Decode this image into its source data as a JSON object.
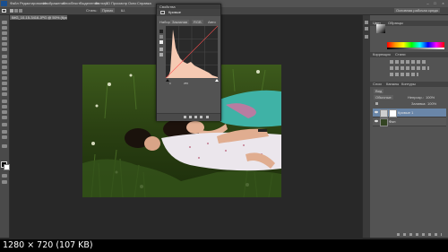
{
  "menubar": {
    "items": [
      "Файл",
      "Редактирование",
      "Изображение",
      "Слои",
      "Текст",
      "Выделение",
      "Фильтр",
      "3D",
      "Просмотр",
      "Окно",
      "Справка"
    ]
  },
  "options_bar": {
    "mode_label": "Стиль:",
    "mode_value": "Прямо",
    "field_label": "Ш.",
    "refine_button": "Уточн. край...",
    "workspace": "Основная рабочая среда"
  },
  "document": {
    "tab_title": "IMG_10-15-3416.JPG @ 50% (Кривые 1, Слой-маска/8) *"
  },
  "properties_panel": {
    "tab_label": "Свойства",
    "title": "Кривые",
    "preset_label": "Набор:",
    "preset_value": "Заказная",
    "channel_value": "RGB",
    "auto_button": "Авто",
    "input_value": "0",
    "output_value": "255"
  },
  "right_panels": {
    "color_tab": "Цвет",
    "swatches_tab": "Образцы",
    "adjustments_tab": "Коррекция",
    "styles_tab": "Стили",
    "layers_tab": "Слои",
    "channels_tab": "Каналы",
    "paths_tab": "Контуры",
    "kind_filter": "Вид",
    "blend_mode": "Обычные",
    "opacity_label": "Непрозр.:",
    "opacity_value": "100%",
    "fill_label": "Заливка:",
    "fill_value": "100%",
    "layers": [
      {
        "name": "Кривые 1",
        "selected": true
      },
      {
        "name": "Фон",
        "selected": false
      }
    ]
  },
  "status_bar": {
    "text": "1280 × 720 (107 KB)"
  },
  "icons": {
    "eye": "eye-icon",
    "lock": "lock-icon",
    "move": "move-tool-icon",
    "marquee": "marquee-tool-icon"
  },
  "colors": {
    "workspace_bg": "#282828",
    "panel_bg": "#535353",
    "histogram_fill": "#f5c9b2",
    "curve_line": "#ff5050",
    "selection": "#6a86a8"
  }
}
